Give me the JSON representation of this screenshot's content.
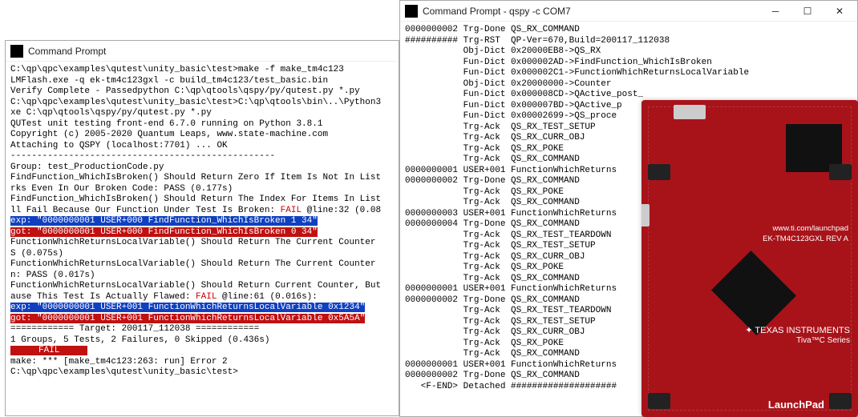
{
  "win1": {
    "title": "Command Prompt",
    "lines": [
      "C:\\qp\\qpc\\examples\\qutest\\unity_basic\\test>make -f make_tm4c123",
      "LMFlash.exe -q ek-tm4c123gxl -c build_tm4c123/test_basic.bin",
      "Verify Complete - Passedpython C:\\qp\\qtools\\qspy/py/qutest.py *.py",
      "",
      "C:\\qp\\qpc\\examples\\qutest\\unity_basic\\test>C:\\qp\\qtools\\bin\\..\\Python3",
      "xe C:\\qp\\qtools\\qspy/py/qutest.py *.py",
      "QUTest unit testing front-end 6.7.0 running on Python 3.8.1",
      "Copyright (c) 2005-2020 Quantum Leaps, www.state-machine.com",
      "Attaching to QSPY (localhost:7701) ... OK",
      "--------------------------------------------------",
      "Group: test_ProductionCode.py",
      "FindFunction_WhichIsBroken() Should Return Zero If Item Is Not In List",
      "rks Even In Our Broken Code: PASS (0.177s)",
      "FindFunction_WhichIsBroken() Should Return The Index For Items In List"
    ],
    "fail1": "ll Fail Because Our Function Under Test Is Broken: FAIL @line:32 (0.08",
    "fail1_plain": "ll Fail Because Our Function Under Test Is Broken: ",
    "fail1_fail": "FAIL",
    "fail1_after": " @line:32 (0.08",
    "exp1": "exp: \"0000000001 USER+000 FindFunction_WhichIsBroken 1 34\"",
    "got1": "got: \"0000000001 USER+000 FindFunction_WhichIsBroken 0 34\"",
    "lines2": [
      "FunctionWhichReturnsLocalVariable() Should Return The Current Counter",
      "S (0.075s)",
      "FunctionWhichReturnsLocalVariable() Should Return The Current Counter",
      "n: PASS (0.017s)"
    ],
    "fail2_plain": "FunctionWhichReturnsLocalVariable() Should Return Current Counter, But",
    "fail2b_plain": "ause This Test Is Actually Flawed: ",
    "fail2b_fail": "FAIL",
    "fail2b_after": " @line:61 (0.016s):",
    "exp2": "exp: \"0000000001 USER+001 FunctionWhichReturnsLocalVariable 0x1234\"",
    "got2": "got: \"0000000001 USER+001 FunctionWhichReturnsLocalVariable 0x5A5A\"",
    "lines3": [
      "============ Target: 200117_112038 ============",
      "1 Groups, 5 Tests, 2 Failures, 0 Skipped (0.436s)"
    ],
    "failbox": "     FAIL     ",
    "lines4": [
      "make: *** [make_tm4c123:263: run] Error 2",
      "",
      "C:\\qp\\qpc\\examples\\qutest\\unity_basic\\test>"
    ]
  },
  "win2": {
    "title": "Command Prompt - qspy  -c COM7",
    "lines": [
      "0000000002 Trg-Done QS_RX_COMMAND",
      "########## Trg-RST  QP-Ver=670,Build=200117_112038",
      "           Obj-Dict 0x20000EB8->QS_RX",
      "           Fun-Dict 0x000002AD->FindFunction_WhichIsBroken",
      "           Fun-Dict 0x000002C1->FunctionWhichReturnsLocalVariable",
      "           Obj-Dict 0x20000000->Counter",
      "           Fun-Dict 0x000008CD->QActive_post_",
      "           Fun-Dict 0x000007BD->QActive_p",
      "           Fun-Dict 0x00002699->QS_proce",
      "           Trg-Ack  QS_RX_TEST_SETUP",
      "           Trg-Ack  QS_RX_CURR_OBJ",
      "           Trg-Ack  QS_RX_POKE",
      "           Trg-Ack  QS_RX_COMMAND",
      "0000000001 USER+001 FunctionWhichReturns",
      "0000000002 Trg-Done QS_RX_COMMAND",
      "           Trg-Ack  QS_RX_POKE",
      "           Trg-Ack  QS_RX_COMMAND",
      "0000000003 USER+001 FunctionWhichReturns",
      "0000000004 Trg-Done QS_RX_COMMAND",
      "           Trg-Ack  QS_RX_TEST_TEARDOWN",
      "           Trg-Ack  QS_RX_TEST_SETUP",
      "           Trg-Ack  QS_RX_CURR_OBJ",
      "           Trg-Ack  QS_RX_POKE",
      "           Trg-Ack  QS_RX_COMMAND",
      "0000000001 USER+001 FunctionWhichReturns",
      "0000000002 Trg-Done QS_RX_COMMAND",
      "           Trg-Ack  QS_RX_TEST_TEARDOWN",
      "           Trg-Ack  QS_RX_TEST_SETUP",
      "           Trg-Ack  QS_RX_CURR_OBJ",
      "           Trg-Ack  QS_RX_POKE",
      "           Trg-Ack  QS_RX_COMMAND",
      "0000000001 USER+001 FunctionWhichReturns",
      "0000000002 Trg-Done QS_RX_COMMAND",
      "   <F-END> Detached ####################"
    ]
  },
  "board": {
    "vendor": "TEXAS INSTRUMENTS",
    "url": "www.ti.com/launchpad",
    "model": "EK-TM4C123GXL  REV A",
    "series": "Tiva™C Series",
    "product": "LaunchPad"
  }
}
